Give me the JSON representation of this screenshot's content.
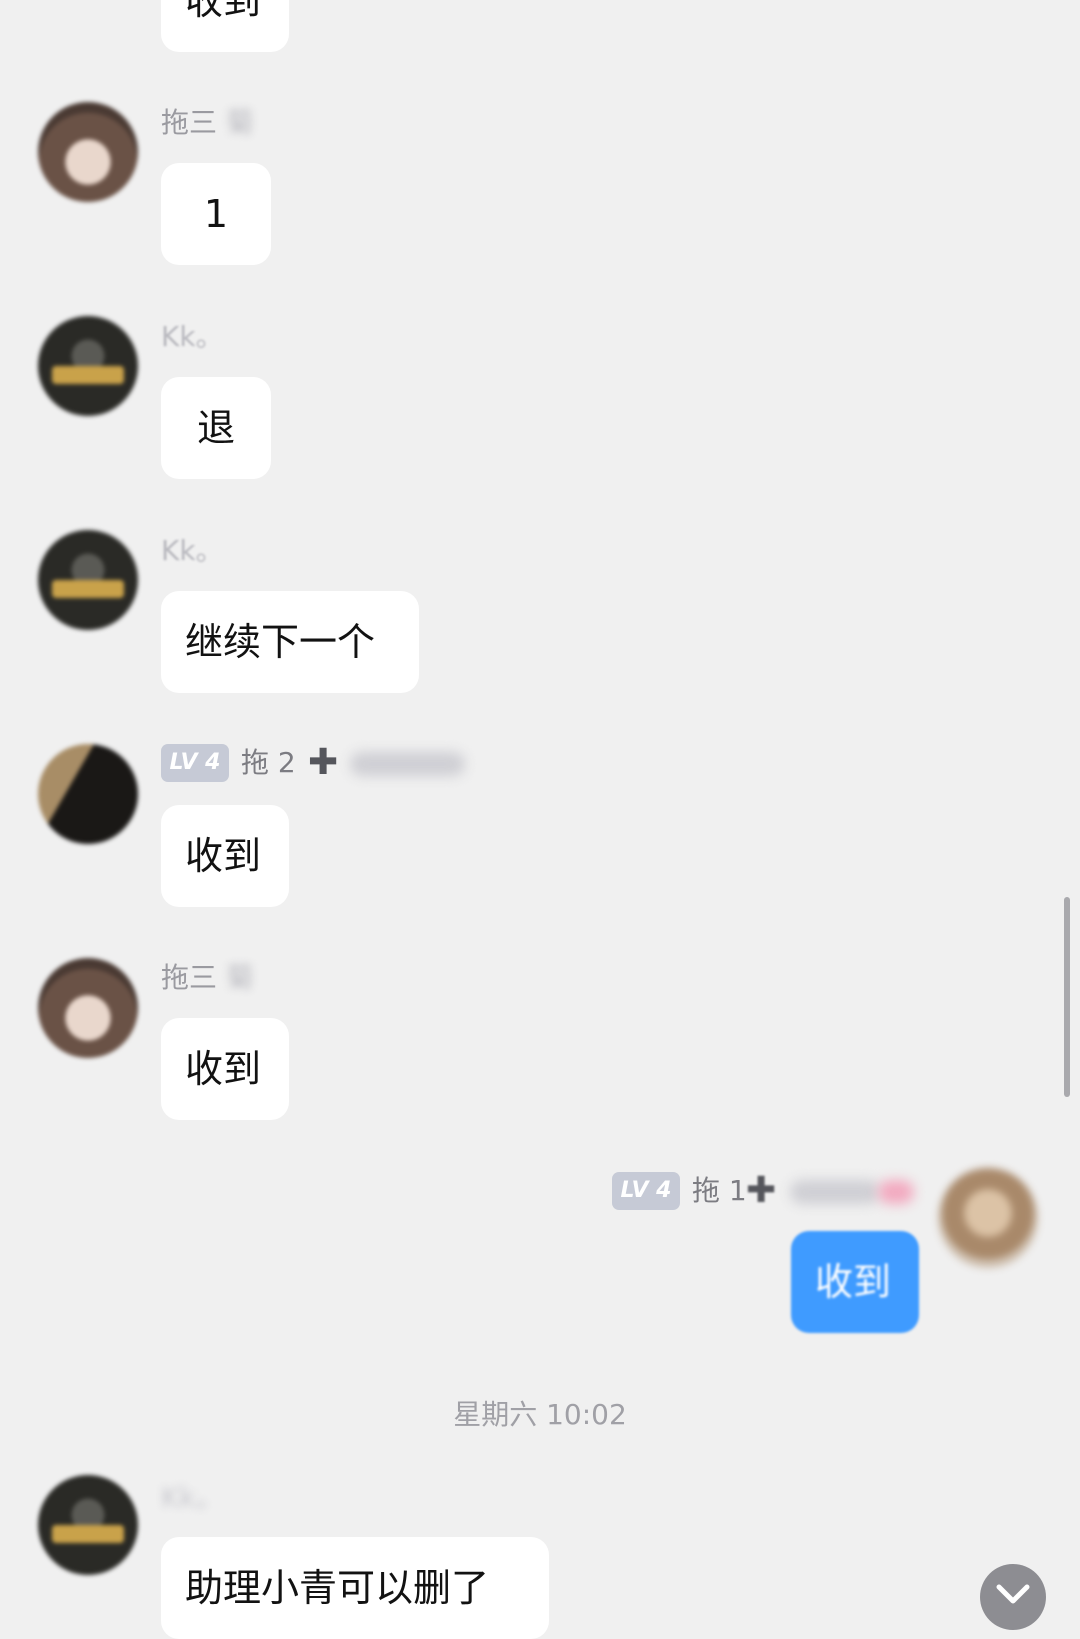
{
  "messages": [
    {
      "sender": "",
      "text": "收到"
    },
    {
      "sender": "拖三",
      "sender_blurred": "菊",
      "text": "1"
    },
    {
      "sender": "Kk。",
      "text": "退"
    },
    {
      "sender": "Kk。",
      "text": "继续下一个"
    },
    {
      "level": "LV 4",
      "sender": "拖 2",
      "text": "收到"
    },
    {
      "sender": "拖三",
      "sender_blurred": "菊",
      "text": "收到"
    },
    {
      "level": "LV 4",
      "sender": "拖 1",
      "text": "收到",
      "self": true
    }
  ],
  "timestamp": "星期六 10:02",
  "last_message": {
    "sender": "Kk。",
    "text": "助理小青可以删了"
  }
}
